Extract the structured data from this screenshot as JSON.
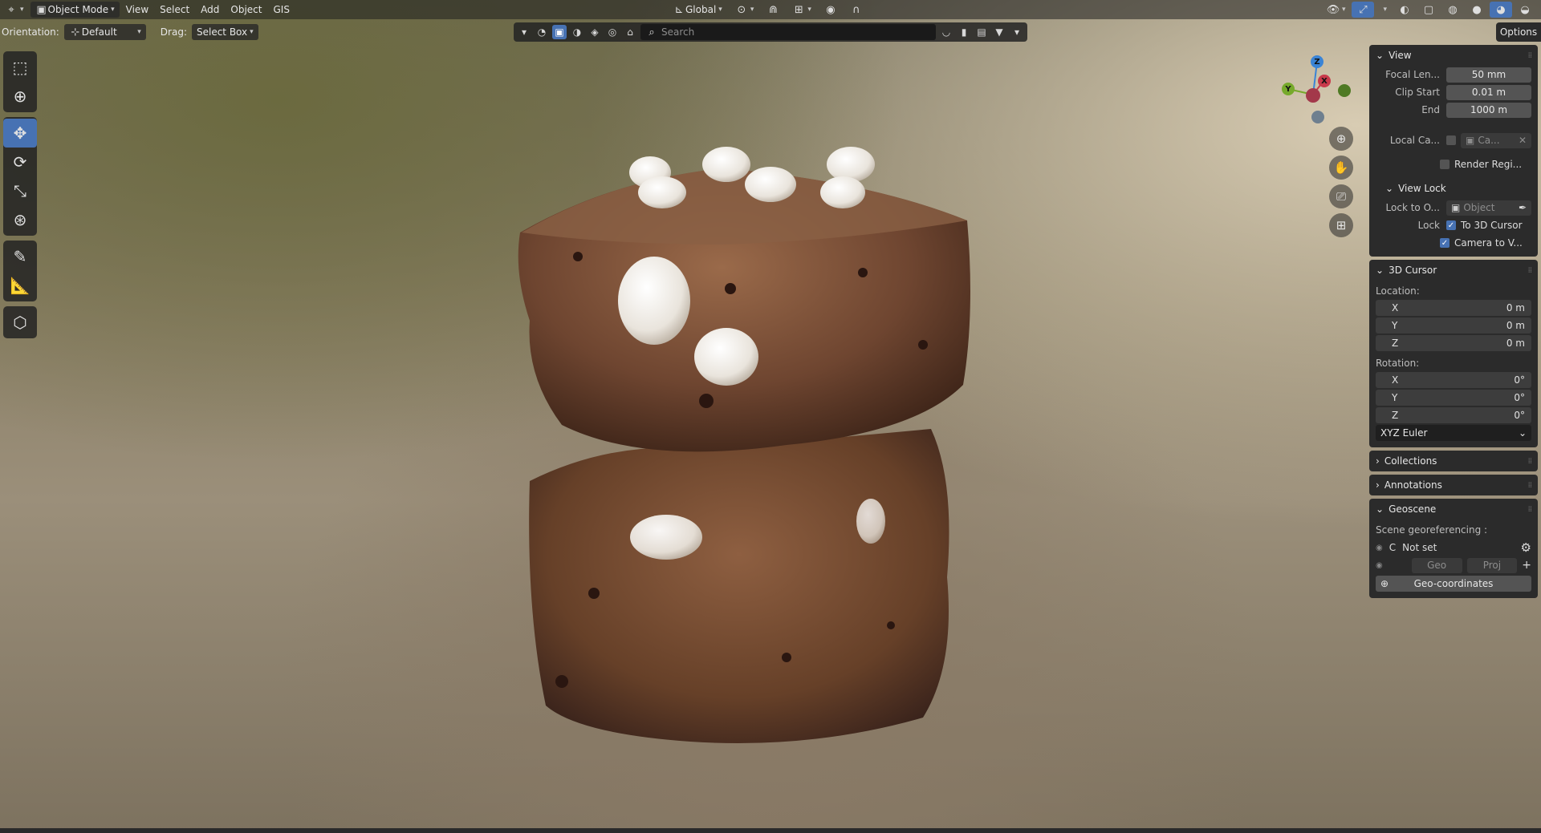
{
  "header": {
    "editor_icon": "3d-viewport-icon",
    "mode": "Object Mode",
    "menus": [
      "View",
      "Select",
      "Add",
      "Object",
      "GIS"
    ],
    "transform_orientation": "Global"
  },
  "subheader": {
    "orientation_label": "Orientation:",
    "orientation_value": "Default",
    "drag_label": "Drag:",
    "drag_value": "Select Box"
  },
  "filterbar": {
    "search_placeholder": "Search"
  },
  "options_label": "Options",
  "gizmo": {
    "z": "Z",
    "y": "Y",
    "x": "X",
    "colors": {
      "x": "#c8394a",
      "y": "#76a92b",
      "z": "#3a84d6",
      "neg": "#6e7f8f"
    }
  },
  "sidebar": {
    "view": {
      "title": "View",
      "focal_label": "Focal Len...",
      "focal_value": "50 mm",
      "clip_start_label": "Clip Start",
      "clip_start_value": "0.01 m",
      "end_label": "End",
      "end_value": "1000 m",
      "local_cam_label": "Local Ca...",
      "local_cam_value": "Ca...",
      "render_region_label": "Render Regi..."
    },
    "view_lock": {
      "title": "View Lock",
      "lock_obj_label": "Lock to O...",
      "lock_obj_value": "Object",
      "lock_label": "Lock",
      "to_cursor": "To 3D Cursor",
      "camera_to_view": "Camera to V..."
    },
    "cursor": {
      "title": "3D Cursor",
      "location_label": "Location:",
      "loc": [
        {
          "axis": "X",
          "value": "0 m"
        },
        {
          "axis": "Y",
          "value": "0 m"
        },
        {
          "axis": "Z",
          "value": "0 m"
        }
      ],
      "rotation_label": "Rotation:",
      "rot": [
        {
          "axis": "X",
          "value": "0°"
        },
        {
          "axis": "Y",
          "value": "0°"
        },
        {
          "axis": "Z",
          "value": "0°"
        }
      ],
      "rotation_mode": "XYZ Euler"
    },
    "collections": {
      "title": "Collections"
    },
    "annotations": {
      "title": "Annotations"
    },
    "geoscene": {
      "title": "Geoscene",
      "scene_label": "Scene georeferencing :",
      "crs_code": "C",
      "crs_value": "Not set",
      "geo_btn": "Geo",
      "proj_btn": "Proj",
      "geo_coords_btn": "Geo-coordinates"
    }
  }
}
